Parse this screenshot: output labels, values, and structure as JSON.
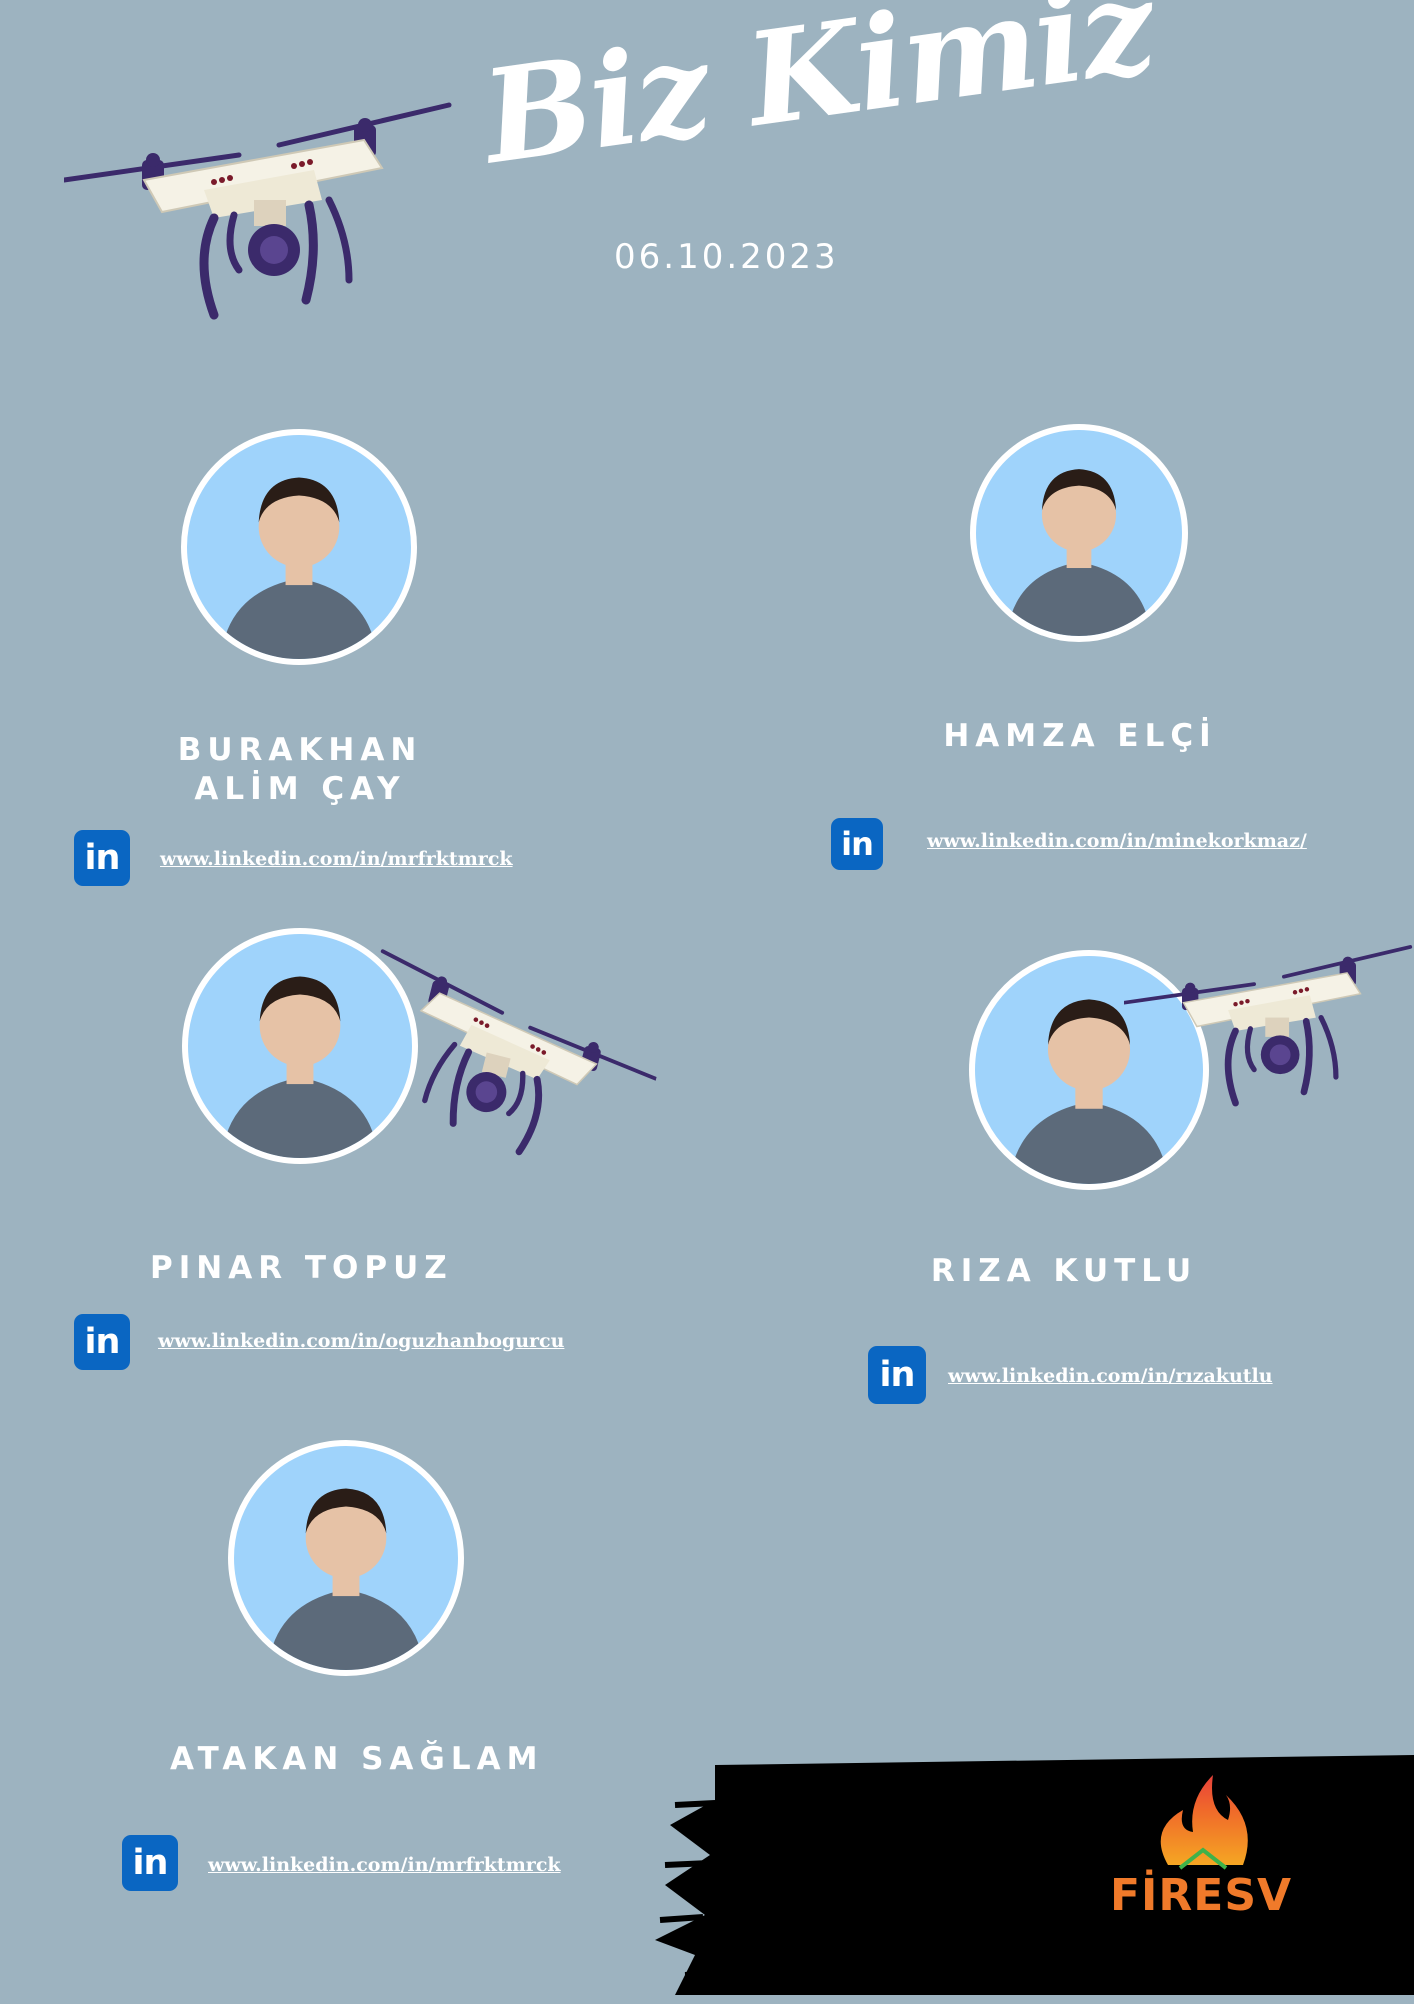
{
  "header": {
    "title": "Biz Kimiz",
    "date": "06.10.2023"
  },
  "members": [
    {
      "name_line1": "BURAKHAN",
      "name_line2": "ALİM ÇAY",
      "link": "www.linkedin.com/in/mrfrktmrck"
    },
    {
      "name_line1": "HAMZA ELÇİ",
      "link": "www.linkedin.com/in/minekorkmaz/"
    },
    {
      "name_line1": "PINAR TOPUZ",
      "link": "www.linkedin.com/in/oguzhanbogurcu"
    },
    {
      "name_line1": "RIZA KUTLU",
      "link": "www.linkedin.com/in/rızakutlu"
    },
    {
      "name_line1": "ATAKAN SAĞLAM",
      "link": "www.linkedin.com/in/mrfrktmrck"
    }
  ],
  "linkedin_icon_text": "in",
  "logo": {
    "text": "FİRESV"
  },
  "colors": {
    "background": "#9db3c0",
    "linkedin": "#0a66c2",
    "avatar_bg": "#9fd3fb",
    "drone_body": "#f5f2e6",
    "drone_purple": "#3b2a6b"
  },
  "icons": [
    "drone-icon",
    "linkedin-icon",
    "person-avatar",
    "fire-logo"
  ]
}
